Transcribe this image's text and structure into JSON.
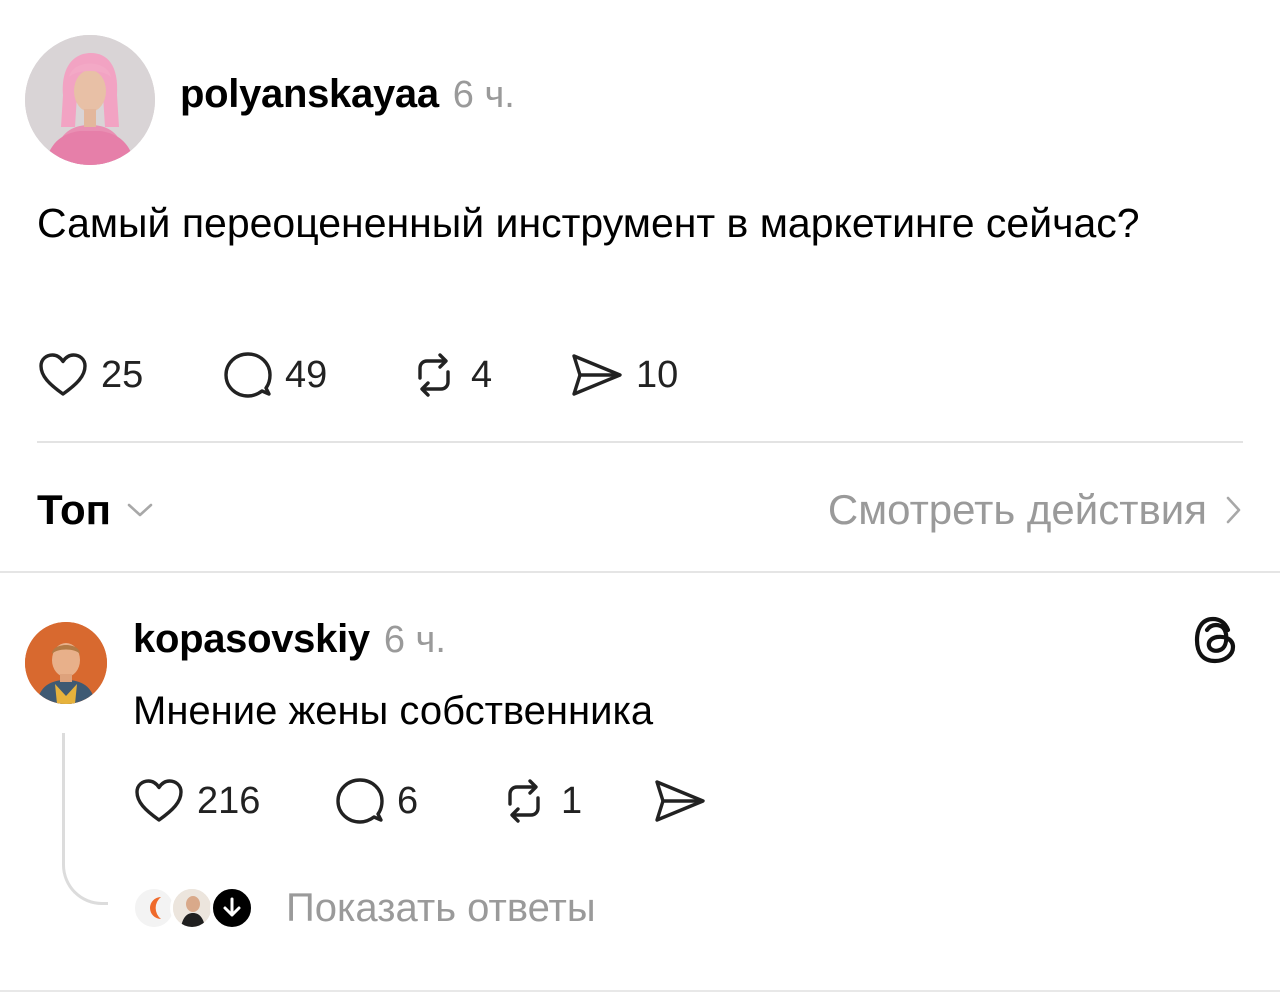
{
  "post": {
    "username": "polyanskayaa",
    "time": "6 ч.",
    "text": "Самый переоцененный инструмент в маркетинге сейчас?",
    "likes": "25",
    "comments": "49",
    "reposts": "4",
    "shares": "10"
  },
  "sort": {
    "label": "Топ",
    "view_activity": "Смотреть действия"
  },
  "reply": {
    "username": "kopasovskiy",
    "time": "6 ч.",
    "text": "Мнение жены собственника",
    "likes": "216",
    "comments": "6",
    "reposts": "1",
    "show_replies": "Показать ответы"
  },
  "icons": {
    "like": "heart-icon",
    "comment": "comment-bubble-icon",
    "repost": "repost-icon",
    "share": "send-icon",
    "sort": "chevron-down-icon",
    "activity": "chevron-right-icon",
    "app": "threads-logo-icon"
  },
  "colors": {
    "text": "#000000",
    "muted": "#9a9a9a",
    "divider": "#e3e3e3"
  }
}
